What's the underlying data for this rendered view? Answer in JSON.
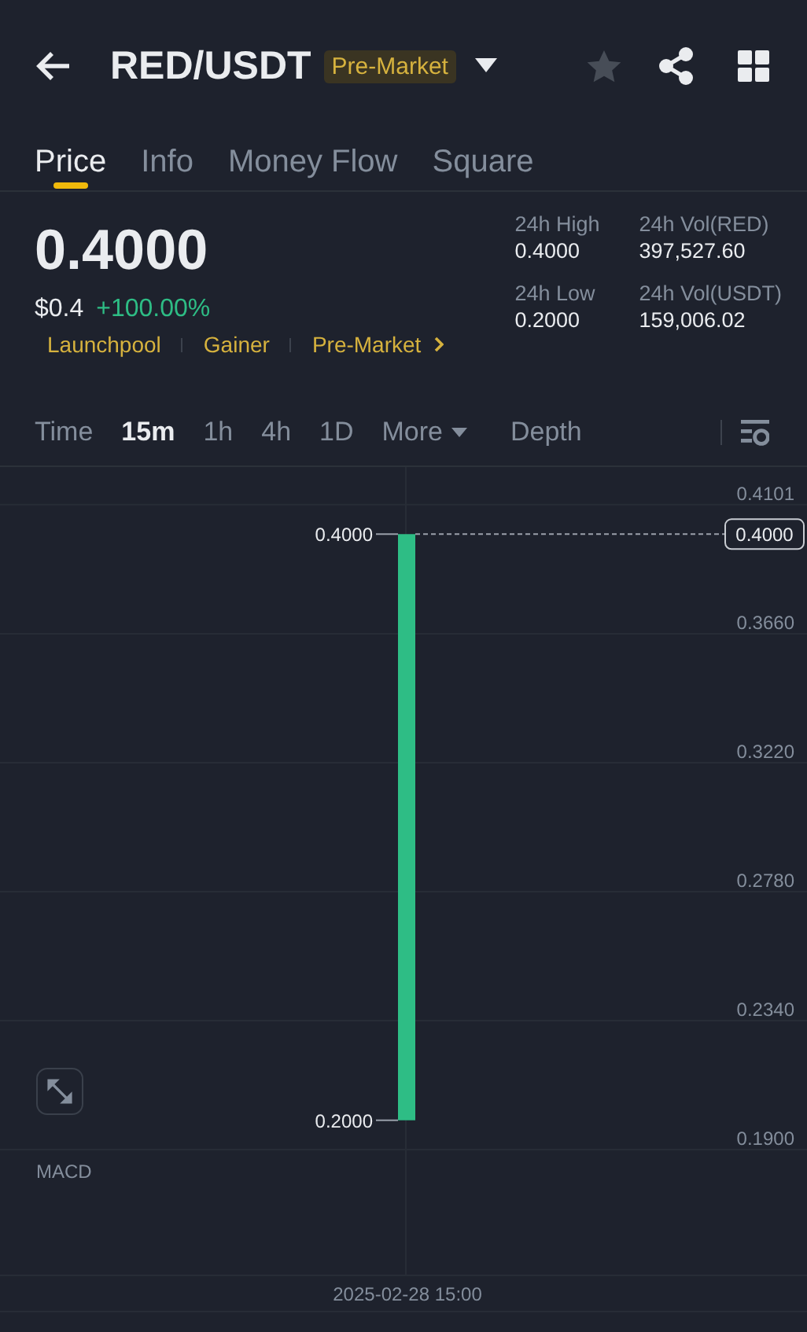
{
  "header": {
    "title": "RED/USDT",
    "badge": "Pre-Market",
    "favorite": false
  },
  "tabs": [
    {
      "label": "Price",
      "selected": true
    },
    {
      "label": "Info",
      "selected": false
    },
    {
      "label": "Money Flow",
      "selected": false
    },
    {
      "label": "Square",
      "selected": false
    }
  ],
  "ticker": {
    "price": "0.4000",
    "fiat_price": "$0.4",
    "change": "+100.00%",
    "rising": true,
    "tags": [
      {
        "label": "Launchpool",
        "link": false
      },
      {
        "label": "Gainer",
        "link": false
      },
      {
        "label": "Pre-Market",
        "link": true
      }
    ],
    "stats": [
      {
        "label": "24h High",
        "value": "0.4000"
      },
      {
        "label": "24h Vol(RED)",
        "value": "397,527.60"
      },
      {
        "label": "24h Low",
        "value": "0.2000"
      },
      {
        "label": "24h Vol(USDT)",
        "value": "159,006.02"
      }
    ]
  },
  "intervals": [
    {
      "label": "Time",
      "selected": false,
      "kind": "option"
    },
    {
      "label": "15m",
      "selected": true,
      "kind": "option"
    },
    {
      "label": "1h",
      "selected": false,
      "kind": "option"
    },
    {
      "label": "4h",
      "selected": false,
      "kind": "option"
    },
    {
      "label": "1D",
      "selected": false,
      "kind": "option"
    },
    {
      "label": "More",
      "selected": false,
      "kind": "menu"
    },
    {
      "label": "Depth",
      "selected": false,
      "kind": "option"
    }
  ],
  "chart": {
    "y_ticks": [
      "0.4101",
      "0.3660",
      "0.3220",
      "0.2780",
      "0.2340",
      "0.1900"
    ],
    "price_line": "0.4000",
    "candle": {
      "high": "0.4000",
      "low": "0.2000",
      "rising": true
    },
    "x_label": "2025-02-28 15:00",
    "indicator": "MACD"
  }
}
